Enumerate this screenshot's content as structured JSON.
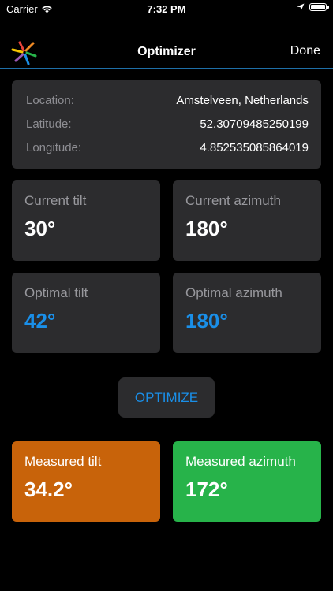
{
  "status_bar": {
    "carrier": "Carrier",
    "time": "7:32 PM"
  },
  "nav": {
    "title": "Optimizer",
    "done_label": "Done"
  },
  "location": {
    "rows": [
      {
        "label": "Location:",
        "value": "Amstelveen, Netherlands"
      },
      {
        "label": "Latitude:",
        "value": "52.30709485250199"
      },
      {
        "label": "Longitude:",
        "value": "4.852535085864019"
      }
    ]
  },
  "cards": {
    "current_tilt": {
      "label": "Current tilt",
      "value": "30°"
    },
    "current_azimuth": {
      "label": "Current azimuth",
      "value": "180°"
    },
    "optimal_tilt": {
      "label": "Optimal tilt",
      "value": "42°"
    },
    "optimal_azimuth": {
      "label": "Optimal azimuth",
      "value": "180°"
    },
    "measured_tilt": {
      "label": "Measured tilt",
      "value": "34.2°"
    },
    "measured_azimuth": {
      "label": "Measured azimuth",
      "value": "172°"
    }
  },
  "optimize_label": "OPTIMIZE",
  "colors": {
    "accent_blue": "#1a8fe8",
    "measured_tilt_bg": "#c8630a",
    "measured_azimuth_bg": "#27b34a",
    "card_bg": "#2c2c2e"
  }
}
